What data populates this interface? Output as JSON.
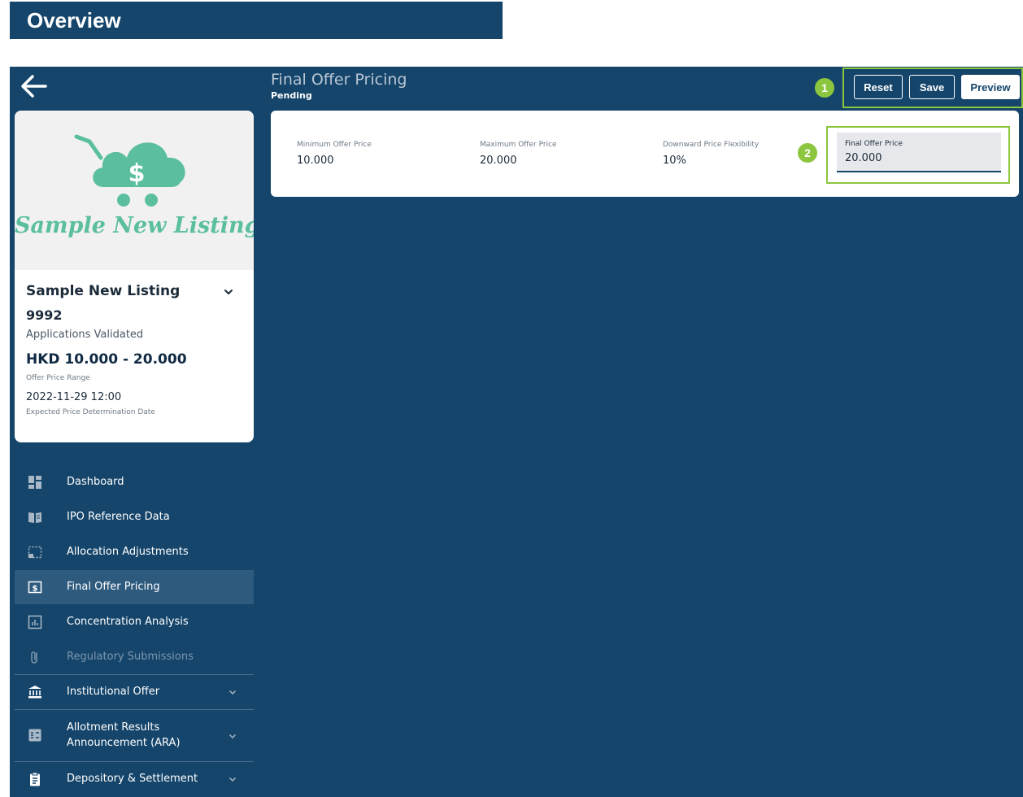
{
  "overview": {
    "title": "Overview"
  },
  "header": {
    "title": "Final Offer Pricing",
    "status": "Pending"
  },
  "toolbar": {
    "reset_label": "Reset",
    "save_label": "Save",
    "preview_label": "Preview"
  },
  "annotations": {
    "badge1": "1",
    "badge2": "2"
  },
  "listing": {
    "logo_text": "Sample New Listing",
    "name": "Sample New Listing",
    "code": "9992",
    "status": "Applications Validated",
    "price_range": "HKD 10.000 - 20.000",
    "price_range_label": "Offer Price Range",
    "date": "2022-11-29 12:00",
    "date_label": "Expected Price Determination Date"
  },
  "nav": {
    "items": [
      {
        "label": "Dashboard",
        "icon": "dashboard-icon"
      },
      {
        "label": "IPO Reference Data",
        "icon": "book-icon"
      },
      {
        "label": "Allocation Adjustments",
        "icon": "selection-icon"
      },
      {
        "label": "Final Offer Pricing",
        "icon": "dollar-icon",
        "active": true
      },
      {
        "label": "Concentration Analysis",
        "icon": "chart-icon"
      },
      {
        "label": "Regulatory Submissions",
        "icon": "paperclip-icon",
        "disabled": true
      },
      {
        "label": "Institutional Offer",
        "icon": "bank-icon",
        "expandable": true
      },
      {
        "label": "Allotment Results\nAnnouncement (ARA)",
        "icon": "list-icon",
        "expandable": true
      },
      {
        "label": "Depository & Settlement",
        "icon": "clipboard-icon",
        "expandable": true
      }
    ]
  },
  "pricing": {
    "min_label": "Minimum Offer Price",
    "min_value": "10.000",
    "max_label": "Maximum Offer Price",
    "max_value": "20.000",
    "flex_label": "Downward Price Flexibility",
    "flex_value": "10%",
    "final_label": "Final Offer Price",
    "final_value": "20.000"
  },
  "colors": {
    "brand": "#15456b",
    "highlight": "#8cc63f",
    "logo": "#5bbf9f"
  }
}
